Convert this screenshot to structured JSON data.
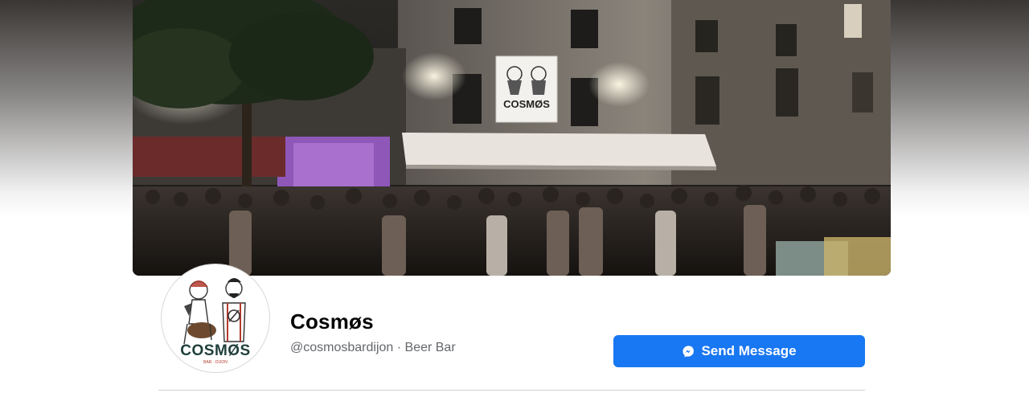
{
  "page": {
    "name": "Cosmøs",
    "handle": "@cosmosbardijon",
    "separator": " · ",
    "category": "Beer Bar"
  },
  "actions": {
    "send_message_label": "Send Message",
    "send_message_icon": "messenger-icon",
    "button_color": "#1877f2"
  },
  "cover": {
    "sign_text": "COSMØS"
  },
  "profile": {
    "logo_text": "COSMØS",
    "logo_subtext": "BAR · DIJON"
  }
}
